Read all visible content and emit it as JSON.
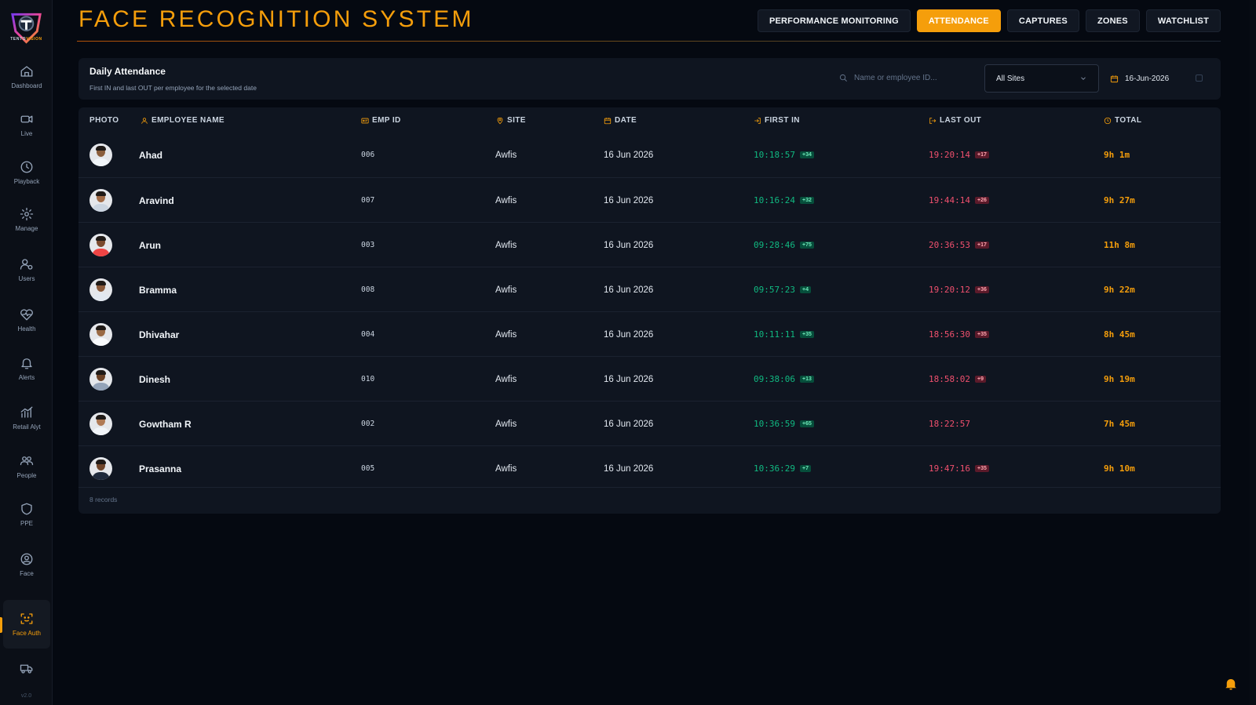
{
  "app": {
    "title": "FACE RECOGNITION SYSTEM",
    "logo_brand": "TENTOVISION",
    "version": "v2.0"
  },
  "sidebar": {
    "items": [
      {
        "label": "Dashboard",
        "icon": "home-icon"
      },
      {
        "label": "Live",
        "icon": "video-camera-icon"
      },
      {
        "label": "Playback",
        "icon": "clock-icon"
      },
      {
        "label": "Manage",
        "icon": "gear-icon"
      },
      {
        "label": "Users",
        "icon": "users-gear-icon"
      },
      {
        "label": "Health",
        "icon": "heart-pulse-icon"
      },
      {
        "label": "Alerts",
        "icon": "bell-icon"
      },
      {
        "label": "Retail Alyt",
        "icon": "bar-chart-icon"
      },
      {
        "label": "People",
        "icon": "people-icon"
      },
      {
        "label": "PPE",
        "icon": "shield-icon"
      },
      {
        "label": "Face",
        "icon": "user-circle-icon"
      },
      {
        "label": "Face Auth",
        "icon": "face-scan-icon"
      },
      {
        "label": "",
        "icon": "truck-icon"
      }
    ],
    "active": "Face Auth"
  },
  "tabs": [
    {
      "label": "PERFORMANCE MONITORING",
      "active": false
    },
    {
      "label": "ATTENDANCE",
      "active": true
    },
    {
      "label": "CAPTURES",
      "active": false
    },
    {
      "label": "ZONES",
      "active": false
    },
    {
      "label": "WATCHLIST",
      "active": false
    }
  ],
  "filter": {
    "title": "Daily Attendance",
    "subtitle": "First IN and last OUT per employee for the selected date",
    "search_placeholder": "Name or employee ID...",
    "site_selected": "All Sites",
    "date": "16-Jun-2026"
  },
  "table": {
    "columns": [
      "PHOTO",
      "EMPLOYEE NAME",
      "EMP ID",
      "SITE",
      "DATE",
      "FIRST IN",
      "LAST OUT",
      "TOTAL"
    ],
    "rows": [
      {
        "name": "Ahad",
        "emp_id": "006",
        "site": "Awfis",
        "date": "16 Jun 2026",
        "first_in": "10:18:57",
        "in_count": "+34",
        "last_out": "19:20:14",
        "out_count": "+17",
        "total": "9h 1m"
      },
      {
        "name": "Aravind",
        "emp_id": "007",
        "site": "Awfis",
        "date": "16 Jun 2026",
        "first_in": "10:16:24",
        "in_count": "+32",
        "last_out": "19:44:14",
        "out_count": "+26",
        "total": "9h 27m"
      },
      {
        "name": "Arun",
        "emp_id": "003",
        "site": "Awfis",
        "date": "16 Jun 2026",
        "first_in": "09:28:46",
        "in_count": "+75",
        "last_out": "20:36:53",
        "out_count": "+17",
        "total": "11h 8m"
      },
      {
        "name": "Bramma",
        "emp_id": "008",
        "site": "Awfis",
        "date": "16 Jun 2026",
        "first_in": "09:57:23",
        "in_count": "+4",
        "last_out": "19:20:12",
        "out_count": "+36",
        "total": "9h 22m"
      },
      {
        "name": "Dhivahar",
        "emp_id": "004",
        "site": "Awfis",
        "date": "16 Jun 2026",
        "first_in": "10:11:11",
        "in_count": "+35",
        "last_out": "18:56:30",
        "out_count": "+35",
        "total": "8h 45m"
      },
      {
        "name": "Dinesh",
        "emp_id": "010",
        "site": "Awfis",
        "date": "16 Jun 2026",
        "first_in": "09:38:06",
        "in_count": "+13",
        "last_out": "18:58:02",
        "out_count": "+9",
        "total": "9h 19m"
      },
      {
        "name": "Gowtham R",
        "emp_id": "002",
        "site": "Awfis",
        "date": "16 Jun 2026",
        "first_in": "10:36:59",
        "in_count": "+65",
        "last_out": "18:22:57",
        "out_count": "",
        "total": "7h 45m"
      },
      {
        "name": "Prasanna",
        "emp_id": "005",
        "site": "Awfis",
        "date": "16 Jun 2026",
        "first_in": "10:36:29",
        "in_count": "+7",
        "last_out": "19:47:16",
        "out_count": "+35",
        "total": "9h 10m"
      }
    ],
    "record_count": "8 records"
  },
  "colors": {
    "accent": "#f59e0b",
    "in_time": "#10b981",
    "out_time": "#f0506e",
    "background": "#050911",
    "panel": "#0f1520"
  }
}
